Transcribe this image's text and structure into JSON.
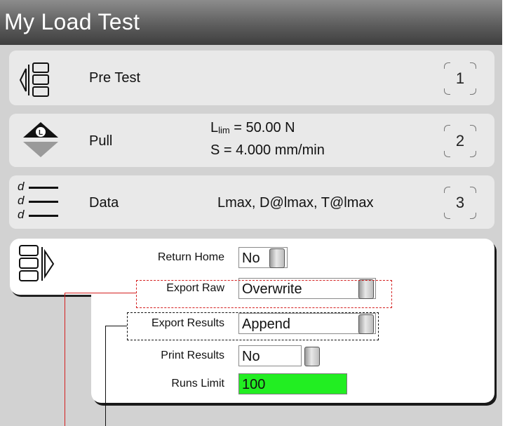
{
  "window": {
    "title": "My Load Test"
  },
  "steps": [
    {
      "label": "Pre Test",
      "number": "1",
      "icon": "pre-test-icon"
    },
    {
      "label": "Pull",
      "number": "2",
      "icon": "pull-icon",
      "params": {
        "limit_symbol": "L",
        "limit_sub": "lim",
        "limit_value": " = 50.00 N",
        "speed": "S = 4.000 mm/min"
      }
    },
    {
      "label": "Data",
      "number": "3",
      "icon": "data-icon",
      "summary": "Lmax, D@lmax, T@lmax",
      "icon_letters": [
        "d",
        "d",
        "d"
      ]
    }
  ],
  "post_test": {
    "icon": "post-test-icon",
    "rows": [
      {
        "label": "Return Home",
        "value": "No"
      },
      {
        "label": "Export Raw",
        "value": "Overwrite"
      },
      {
        "label": "Export Results",
        "value": "Append"
      },
      {
        "label": "Print Results",
        "value": "No"
      },
      {
        "label": "Runs Limit",
        "value": "100"
      }
    ]
  },
  "colors": {
    "runs_limit_bg": "#22ee22",
    "highlight_raw": "#d42020",
    "highlight_results": "#111111"
  }
}
